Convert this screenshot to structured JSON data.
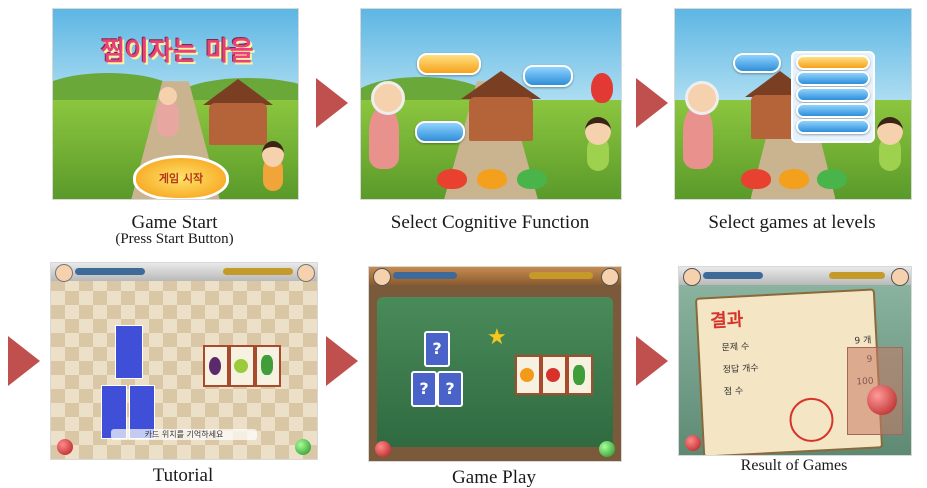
{
  "panels": [
    {
      "id": "game-start",
      "caption": "Game Start",
      "subcaption": "(Press Start Button)",
      "title_ko": "찜이자는 마을",
      "start_button_ko": "게임 시작"
    },
    {
      "id": "select-cognitive-function",
      "caption": "Select Cognitive Function"
    },
    {
      "id": "select-games-at-levels",
      "caption": "Select games at levels"
    },
    {
      "id": "tutorial",
      "caption": "Tutorial",
      "instruction_ko": "카드 위치를 기억하세요"
    },
    {
      "id": "game-play",
      "caption": "Game Play"
    },
    {
      "id": "result-of-games",
      "caption": "Result of Games",
      "result_title_ko": "결과",
      "result_rows": [
        {
          "label": "문제 수",
          "value": "9 개"
        },
        {
          "label": "정답 개수",
          "value": "9"
        },
        {
          "label": "점 수",
          "value": "100"
        }
      ]
    }
  ],
  "flow_arrow_color": "#c0504d"
}
